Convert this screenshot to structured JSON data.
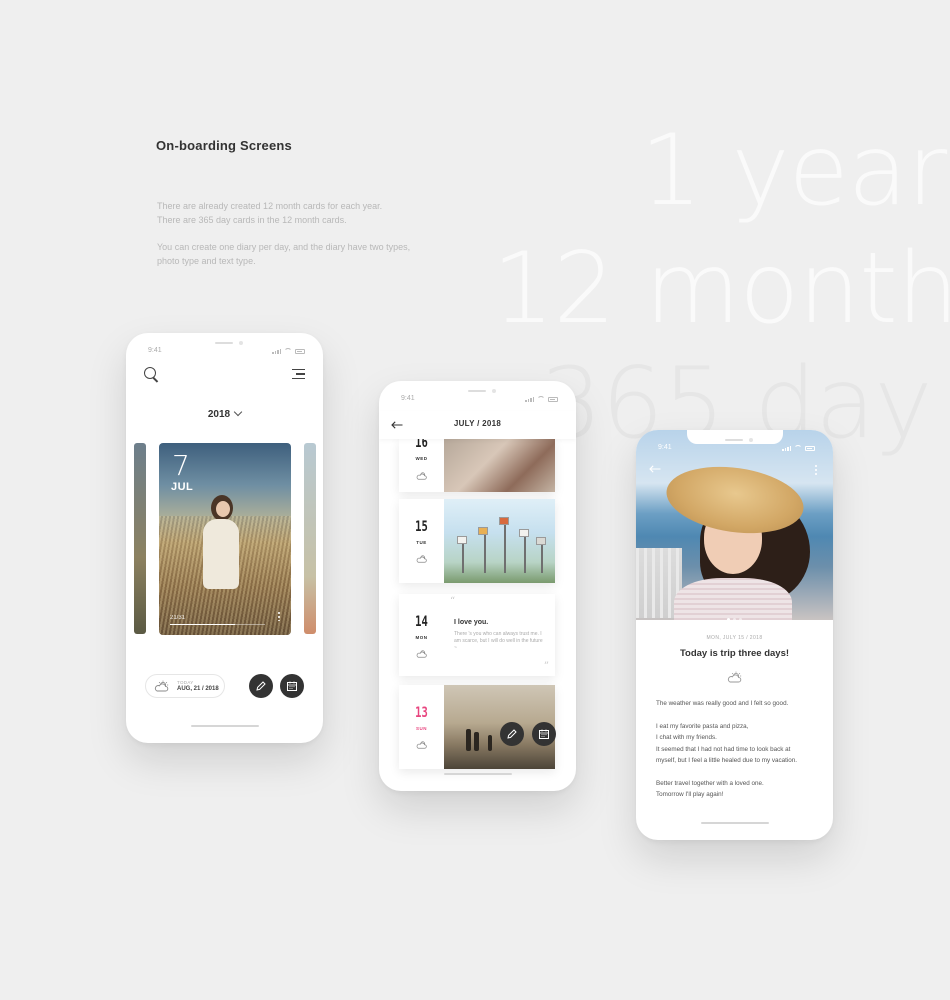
{
  "intro": {
    "title": "On-boarding Screens",
    "para1_line1": "There are already created 12 month cards for each year.",
    "para1_line2": "There are 365 day cards in the 12 month cards.",
    "para2_line1": "You can create one diary per day, and the diary have two types,",
    "para2_line2": "photo type and text type."
  },
  "hero_text": {
    "line1": "1 year",
    "line2": "12 month",
    "line3": "365 day"
  },
  "status": {
    "time": "9:41"
  },
  "screen1": {
    "year": "2018",
    "card": {
      "day": "7",
      "month": "JUL",
      "count": "21/31",
      "progress": 0.68
    },
    "weather": {
      "label": "TODAY",
      "date": "AUG, 21 / 2018",
      "icon": "partly-cloudy-icon"
    }
  },
  "screen2": {
    "title": "JULY / 2018",
    "days": [
      {
        "num": "16",
        "weekday": "WED",
        "type": "photo"
      },
      {
        "num": "15",
        "weekday": "TUE",
        "type": "photo"
      },
      {
        "num": "14",
        "weekday": "MON",
        "type": "text",
        "quote_title": "I love you.",
        "quote_text": "There 's you who can always trust me. I am scarce, but I will do well in the future ~"
      },
      {
        "num": "13",
        "weekday": "SUN",
        "type": "photo",
        "color": "#e8457f"
      }
    ]
  },
  "screen3": {
    "date": "MON, JULY 15 / 2018",
    "title": "Today is trip three days!",
    "paragraphs": [
      [
        "The weather was really good and I felt so good."
      ],
      [
        "I eat my favorite pasta and pizza,",
        "I chat with my friends.",
        "It seemed that I had not had time to look back at",
        "myself, but I feel a little healed due to my vacation."
      ],
      [
        "Better travel together with a loved one.",
        "Tomorrow I'll play again!"
      ]
    ],
    "slide_index": 0,
    "slide_count": 3
  },
  "colors": {
    "accent_pink": "#e8457f",
    "fab": "#333333",
    "background": "#efefef"
  }
}
